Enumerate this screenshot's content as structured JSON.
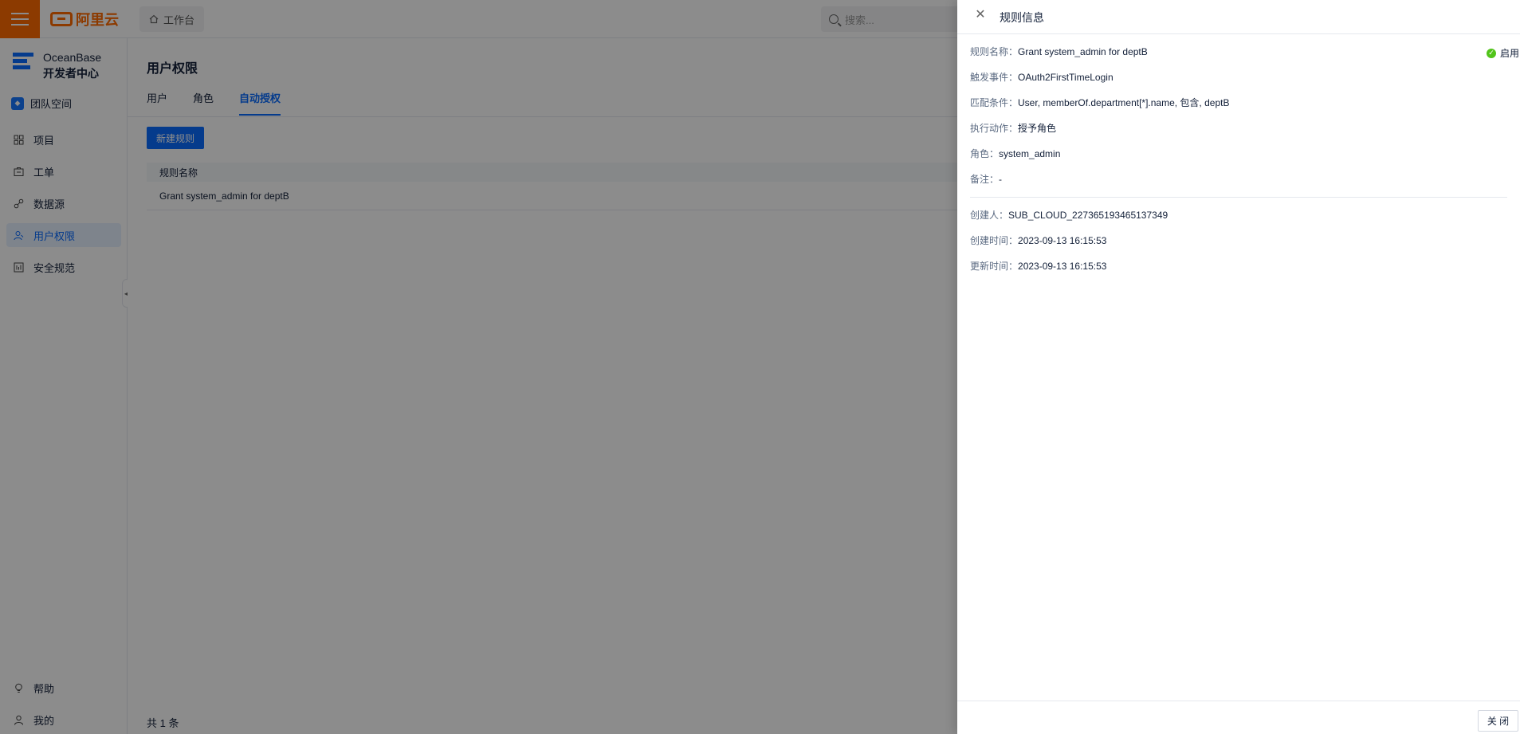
{
  "topbar": {
    "logo_text": "阿里云",
    "workbench_label": "工作台",
    "search_placeholder": "搜索..."
  },
  "sidebar": {
    "brand_line1": "OceanBase",
    "brand_line2": "开发者中心",
    "team_label": "团队空间",
    "items": [
      {
        "label": "项目",
        "icon": "grid-icon"
      },
      {
        "label": "工单",
        "icon": "ticket-icon"
      },
      {
        "label": "数据源",
        "icon": "link-icon"
      },
      {
        "label": "用户权限",
        "icon": "user-permission-icon",
        "active": true
      },
      {
        "label": "安全规范",
        "icon": "security-spec-icon"
      }
    ],
    "bottom_items": [
      {
        "label": "帮助",
        "icon": "bulb-icon"
      },
      {
        "label": "我的",
        "icon": "user-icon"
      }
    ]
  },
  "main": {
    "title": "用户权限",
    "tabs": [
      {
        "label": "用户"
      },
      {
        "label": "角色"
      },
      {
        "label": "自动授权",
        "active": true
      }
    ],
    "new_button_label": "新建规则",
    "table": {
      "header": "规则名称",
      "rows": [
        "Grant system_admin for deptB"
      ]
    },
    "total_text": "共 1 条"
  },
  "drawer": {
    "title": "规则信息",
    "status_label": "启用",
    "fields": [
      {
        "label": "规则名称：",
        "value": "Grant system_admin for deptB"
      },
      {
        "label": "触发事件：",
        "value": "OAuth2FirstTimeLogin"
      },
      {
        "label": "匹配条件：",
        "value": "User, memberOf.department[*].name, 包含, deptB"
      },
      {
        "label": "执行动作：",
        "value": "授予角色"
      },
      {
        "label": "角色：",
        "value": "system_admin"
      },
      {
        "label": "备注：",
        "value": "-"
      }
    ],
    "meta": [
      {
        "label": "创建人：",
        "value": "SUB_CLOUD_227365193465137349"
      },
      {
        "label": "创建时间：",
        "value": "2023-09-13 16:15:53"
      },
      {
        "label": "更新时间：",
        "value": "2023-09-13 16:15:53"
      }
    ],
    "close_button_label": "关 闭"
  },
  "colors": {
    "brand_orange": "#ff6a00",
    "primary_blue": "#0a6cff",
    "success_green": "#52c41a",
    "mask": "rgba(0,0,0,0.45)"
  }
}
